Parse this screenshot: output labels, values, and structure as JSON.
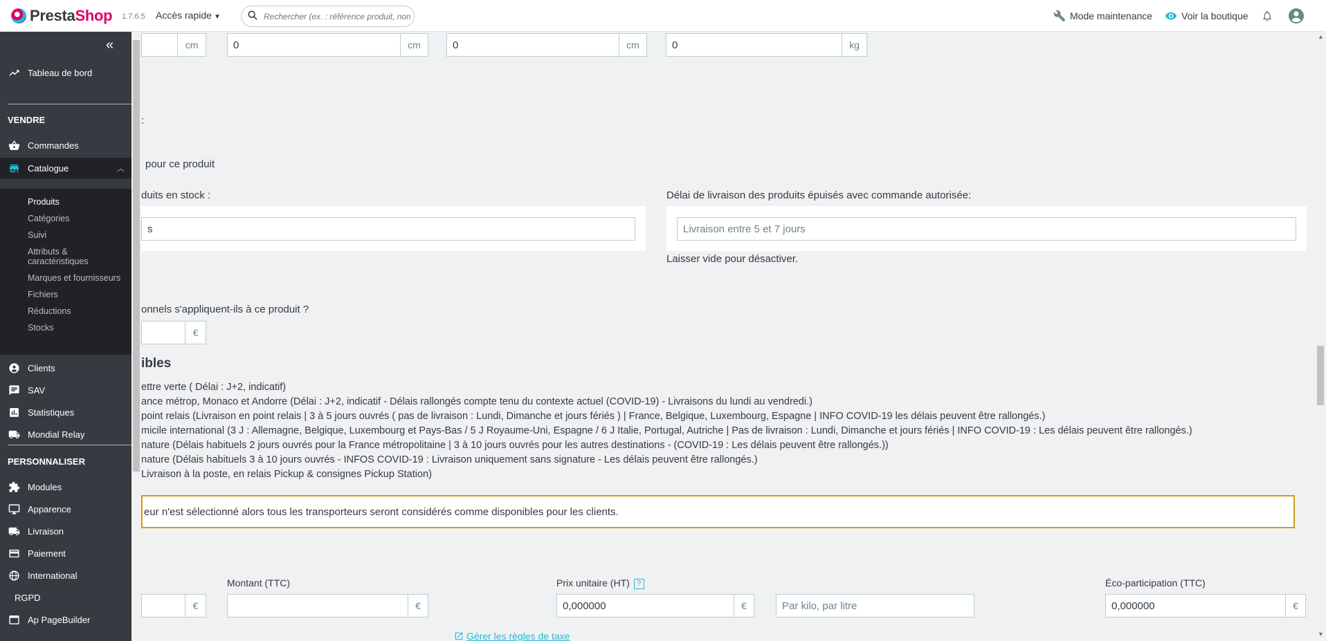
{
  "header": {
    "brand_a": "Presta",
    "brand_b": "Shop",
    "version": "1.7.6.5",
    "quick_access": "Accès rapide",
    "search_placeholder": "Rechercher (ex. : référence produit, nom",
    "maintenance": "Mode maintenance",
    "view_shop": "Voir la boutique"
  },
  "sidebar": {
    "dashboard": "Tableau de bord",
    "section_sell": "VENDRE",
    "orders": "Commandes",
    "catalog": "Catalogue",
    "catalog_sub": [
      "Produits",
      "Catégories",
      "Suivi",
      "Attributs &",
      "caractéristiques",
      "Marques et fournisseurs",
      "Fichiers",
      "Réductions",
      "Stocks"
    ],
    "clients": "Clients",
    "sav": "SAV",
    "stats": "Statistiques",
    "mondial": "Mondial Relay",
    "section_custom": "PERSONNALISER",
    "modules": "Modules",
    "appearance": "Apparence",
    "shipping": "Livraison",
    "payment": "Paiement",
    "international": "International",
    "rgpd": "RGPD",
    "pagebuilder": "Ap PageBuilder"
  },
  "dimensions": {
    "depth_value": "0",
    "weight_value": "0",
    "unit_cm": "cm",
    "unit_kg": "kg"
  },
  "delivery": {
    "colon": ":",
    "for_product": "pour ce produit",
    "in_stock_label": "duits en stock :",
    "in_stock_value": "s",
    "oos_label": "Délai de livraison des produits épuisés avec commande autorisée:",
    "oos_placeholder": "Livraison entre 5 et 7 jours",
    "disable_hint": "Laisser vide pour désactiver."
  },
  "fees": {
    "question": "onnels s'appliquent-ils à ce produit ?",
    "currency": "€"
  },
  "carriers": {
    "title": "ibles",
    "items": [
      "ettre verte ( Délai : J+2, indicatif)",
      "ance métrop, Monaco et Andorre (Délai : J+2, indicatif - Délais rallongés compte tenu du contexte actuel (COVID-19) - Livraisons du lundi au vendredi.)",
      "point relais (Livraison en point relais | 3 à 5 jours ouvrés ( pas de livraison : Lundi, Dimanche et jours fériés ) | France, Belgique, Luxembourg, Espagne | INFO COVID-19 les délais peuvent être rallongés.)",
      "micile international (3 J : Allemagne, Belgique, Luxembourg et Pays-Bas / 5 J Royaume-Uni, Espagne / 6 J Italie, Portugal, Autriche | Pas de livraison : Lundi, Dimanche et jours fériés | INFO COVID-19 : Les délais peuvent être rallongés.)",
      "nature (Délais habituels 2 jours ouvrés pour la France métropolitaine | 3 à 10 jours ouvrés pour les autres destinations - (COVID-19 : Les délais peuvent être rallongés.))",
      "nature (Délais habituels 3 à 10 jours ouvrés - INFOS COVID-19 : Livraison uniquement sans signature - Les délais peuvent être rallongés.)",
      "Livraison à la poste, en relais Pickup & consignes Pickup Station)"
    ],
    "warning": "eur n'est sélectionné alors tous les transporteurs seront considérés comme disponibles pour les clients."
  },
  "pricing": {
    "amount_ttc_label": "Montant (TTC)",
    "unit_price_label": "Prix unitaire (HT)",
    "unit_price_value": "0,000000",
    "unit_placeholder": "Par kilo, par litre",
    "eco_label": "Éco-participation (TTC)",
    "eco_value": "0,000000",
    "help": "?",
    "tax_rules_link": "Gérer les règles de taxe",
    "currency": "€"
  },
  "colors": {
    "sidebar_bg": "#363a41",
    "accent": "#25b9d7",
    "brand_pink": "#df0067",
    "warning_border": "#c7a01f"
  }
}
